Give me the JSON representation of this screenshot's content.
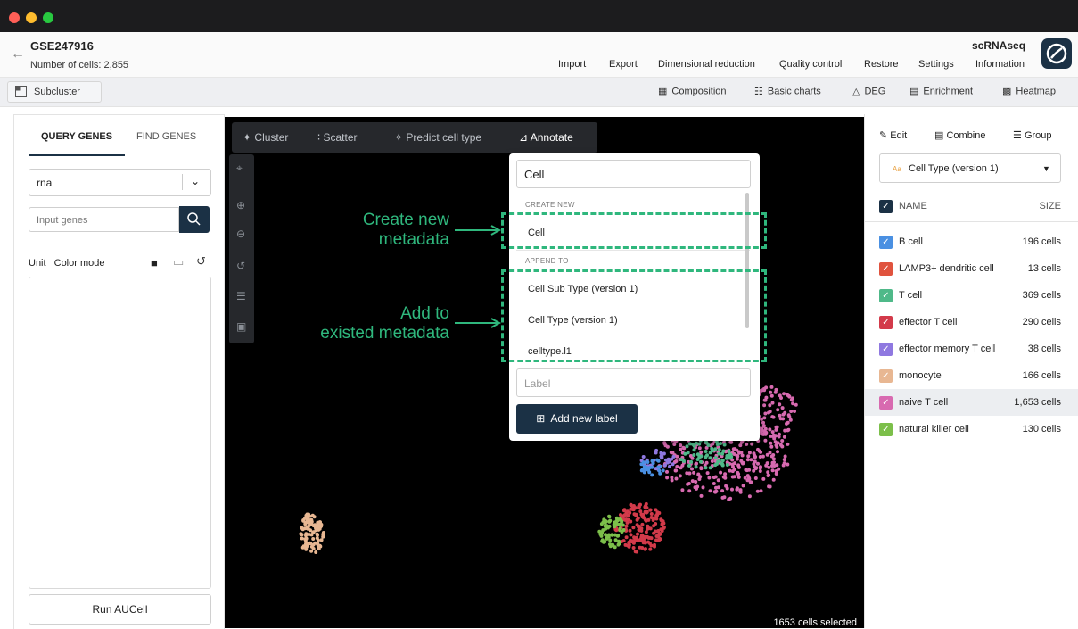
{
  "header": {
    "dataset": "GSE247916",
    "cells_count": "Number of cells: 2,855",
    "app_name": "scRNAseq",
    "menu": [
      "Import",
      "Export",
      "Dimensional reduction",
      "Quality control",
      "Restore",
      "Settings",
      "Information"
    ]
  },
  "toolbar": {
    "subcluster": "Subcluster",
    "tools": [
      "Composition",
      "Basic charts",
      "DEG",
      "Enrichment",
      "Heatmap"
    ]
  },
  "left": {
    "tabs": [
      "QUERY GENES",
      "FIND GENES"
    ],
    "assay": "rna",
    "gene_placeholder": "Input genes",
    "unit": "Unit",
    "color_mode": "Color mode",
    "run_button": "Run AUCell"
  },
  "canvas": {
    "tools": [
      "Cluster",
      "Scatter",
      "Predict cell type",
      "Annotate"
    ],
    "active_tool": "Annotate",
    "selected_info": "1653 cells selected"
  },
  "annotations": {
    "create_new": [
      "Create new",
      "metadata"
    ],
    "add_to": [
      "Add to",
      "existed metadata"
    ]
  },
  "popup": {
    "search_value": "Cell",
    "create_new_header": "CREATE NEW",
    "create_new_item": "Cell",
    "append_to_header": "APPEND TO",
    "append_items": [
      "Cell Sub Type (version 1)",
      "Cell Type (version 1)",
      "celltype.l1"
    ],
    "label_placeholder": "Label",
    "add_button": "Add new label"
  },
  "right": {
    "tools": [
      "Edit",
      "Combine",
      "Group"
    ],
    "metadata_select": "Cell Type (version 1)",
    "metadata_badge": "Aa",
    "col_name": "NAME",
    "col_size": "SIZE",
    "rows": [
      {
        "name": "B cell",
        "size": "196 cells",
        "color": "#4a90e2"
      },
      {
        "name": "LAMP3+ dendritic cell",
        "size": "13 cells",
        "color": "#e0533e"
      },
      {
        "name": "T cell",
        "size": "369 cells",
        "color": "#4fb989"
      },
      {
        "name": "effector T cell",
        "size": "290 cells",
        "color": "#d33a4a"
      },
      {
        "name": "effector memory T cell",
        "size": "38 cells",
        "color": "#8f78e0"
      },
      {
        "name": "monocyte",
        "size": "166 cells",
        "color": "#e8b792"
      },
      {
        "name": "naive T cell",
        "size": "1,653 cells",
        "color": "#d86ab0"
      },
      {
        "name": "natural killer cell",
        "size": "130 cells",
        "color": "#7cbf4a"
      }
    ]
  }
}
